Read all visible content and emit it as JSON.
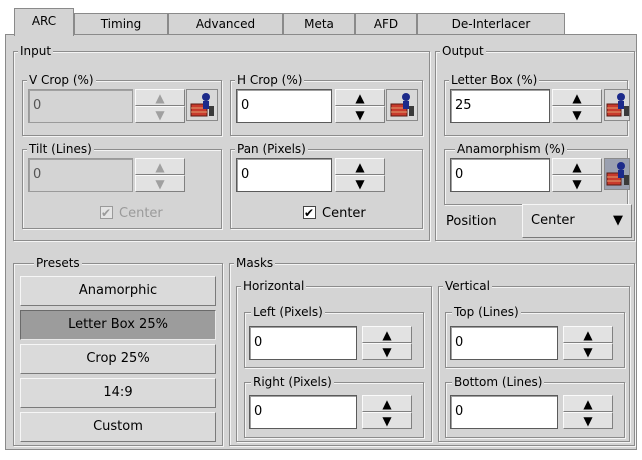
{
  "tabs": [
    {
      "label": "ARC",
      "active": true
    },
    {
      "label": "Timing"
    },
    {
      "label": "Advanced"
    },
    {
      "label": "Meta"
    },
    {
      "label": "AFD"
    },
    {
      "label": "De-Interlacer"
    }
  ],
  "input": {
    "legend": "Input",
    "vcrop": {
      "label": "V Crop (%)",
      "value": "0"
    },
    "hcrop": {
      "label": "H Crop (%)",
      "value": "0"
    },
    "tilt": {
      "label": "Tilt (Lines)",
      "value": "0",
      "center_label": "Center",
      "center_checked": true
    },
    "pan": {
      "label": "Pan (Pixels)",
      "value": "0",
      "center_label": "Center",
      "center_checked": true
    }
  },
  "output": {
    "legend": "Output",
    "letterbox": {
      "label": "Letter Box (%)",
      "value": "25"
    },
    "anamorphism": {
      "label": "Anamorphism (%)",
      "value": "0"
    },
    "position_label": "Position",
    "position_value": "Center"
  },
  "presets": {
    "legend": "Presets",
    "items": [
      "Anamorphic",
      "Letter Box 25%",
      "Crop 25%",
      "14:9",
      "Custom"
    ],
    "selected_index": 1
  },
  "masks": {
    "legend": "Masks",
    "horizontal": {
      "legend": "Horizontal",
      "left": {
        "label": "Left (Pixels)",
        "value": "0"
      },
      "right": {
        "label": "Right (Pixels)",
        "value": "0"
      }
    },
    "vertical": {
      "legend": "Vertical",
      "top": {
        "label": "Top (Lines)",
        "value": "0"
      },
      "bottom": {
        "label": "Bottom (Lines)",
        "value": "0"
      }
    }
  },
  "icons": {
    "lock": "lock-icon",
    "up": "▲",
    "down": "▼"
  },
  "colors": {
    "panel": "#d4d4d4",
    "pressed": "#9c9c9c"
  }
}
